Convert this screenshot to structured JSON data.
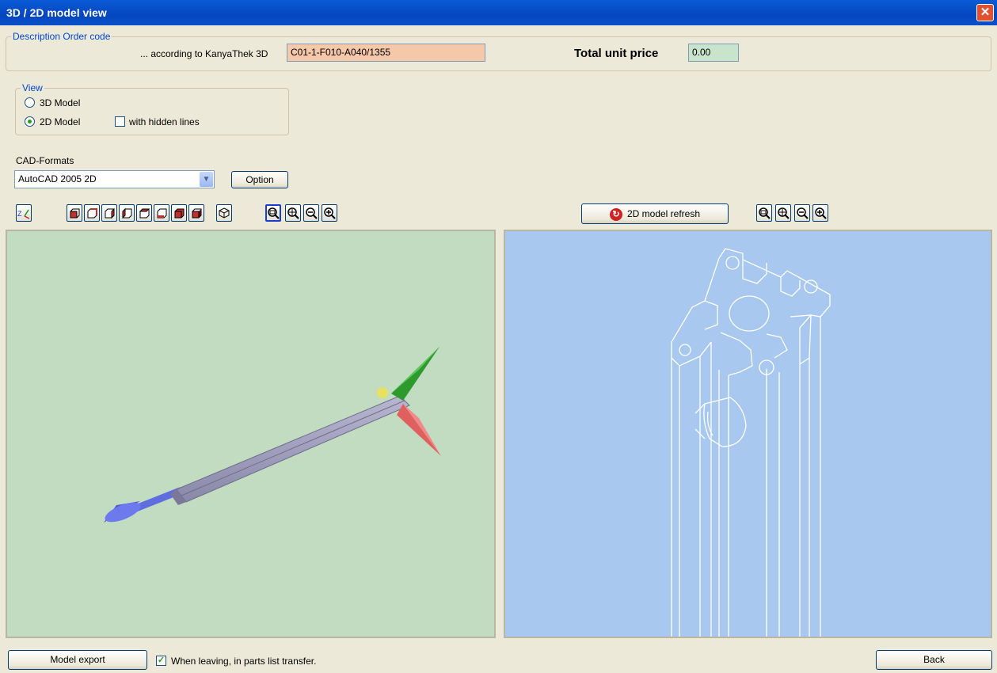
{
  "window": {
    "title": "3D / 2D model view",
    "close_label": "✕"
  },
  "description": {
    "legend": "Description Order code",
    "according_label": "... according to KanyaThek 3D",
    "order_code": "C01-1-F010-A040/1355",
    "total_label": "Total unit price",
    "total_value": "0.00",
    "order_code_bg": "#f4c8a8",
    "total_bg": "#c8e4cd"
  },
  "view": {
    "legend": "View",
    "option_3d": "3D Model",
    "option_2d": "2D Model",
    "hidden_lines_label": "with hidden lines",
    "selected": "2D Model",
    "hidden_lines_checked": false
  },
  "cad": {
    "label": "CAD-Formats",
    "selected": "AutoCAD 2005  2D",
    "option_button": "Option"
  },
  "toolbar": {
    "refresh_button": "2D model refresh",
    "left_icons": [
      "axis-icon",
      "cube-front-icon",
      "cube-back-icon",
      "cube-left-icon",
      "cube-right-icon",
      "cube-top-icon",
      "cube-bottom-icon",
      "cube-iso-icon"
    ],
    "zoom_icons": [
      "zoom-window-icon",
      "zoom-extents-icon",
      "zoom-out-icon",
      "zoom-in-icon"
    ]
  },
  "panes": {
    "left_bg": "#c1dcc0",
    "right_bg": "#a8c8f0"
  },
  "footer": {
    "export_button": "Model export",
    "transfer_label": "When leaving, in parts list transfer.",
    "transfer_checked": true,
    "back_button": "Back"
  }
}
